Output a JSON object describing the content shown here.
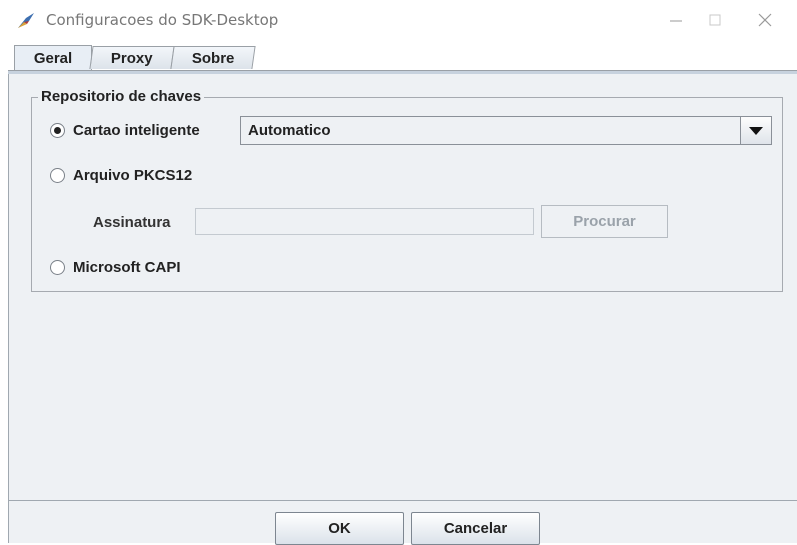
{
  "window": {
    "title": "Configuracoes do SDK-Desktop",
    "icons": {
      "app": "feather-tool-icon",
      "minimize": "minimize-icon",
      "maximize": "maximize-icon",
      "close": "close-icon"
    }
  },
  "tabs": [
    {
      "label": "Geral",
      "selected": true
    },
    {
      "label": "Proxy",
      "selected": false
    },
    {
      "label": "Sobre",
      "selected": false
    }
  ],
  "keystore": {
    "legend": "Repositorio de chaves",
    "options": [
      {
        "label": "Cartao inteligente",
        "selected": true
      },
      {
        "label": "Arquivo PKCS12",
        "selected": false
      },
      {
        "label": "Microsoft CAPI",
        "selected": false
      }
    ],
    "smartcard_combo": {
      "value": "Automatico",
      "arrow_icon": "dropdown-arrow-icon"
    },
    "signature": {
      "label": "Assinatura",
      "value": "",
      "browse_label": "Procurar",
      "enabled": false
    }
  },
  "footer": {
    "ok_label": "OK",
    "cancel_label": "Cancelar"
  },
  "colors": {
    "panel": "#eef1f4",
    "tab_selected": "#e8eef5",
    "border": "#a0a8b0",
    "disabled_text": "#9aa2aa"
  }
}
